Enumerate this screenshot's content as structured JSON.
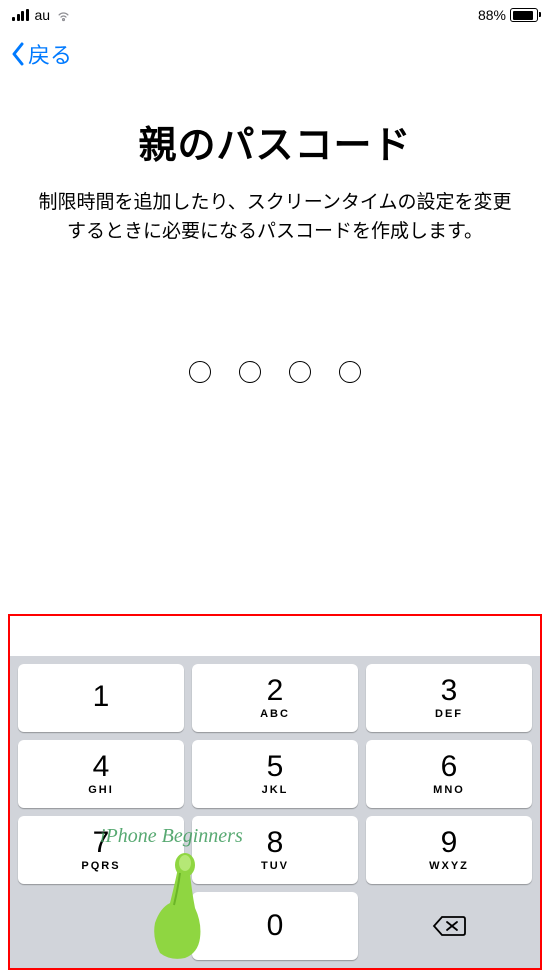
{
  "status_bar": {
    "carrier": "au",
    "battery_percent": "88%"
  },
  "nav": {
    "back_label": "戻る"
  },
  "content": {
    "title": "親のパスコード",
    "subtitle": "制限時間を追加したり、スクリーンタイムの設定を変更するときに必要になるパスコードを作成します。"
  },
  "passcode": {
    "length": 4,
    "filled": 0
  },
  "keypad": {
    "keys": [
      {
        "num": "1",
        "letters": ""
      },
      {
        "num": "2",
        "letters": "ABC"
      },
      {
        "num": "3",
        "letters": "DEF"
      },
      {
        "num": "4",
        "letters": "GHI"
      },
      {
        "num": "5",
        "letters": "JKL"
      },
      {
        "num": "6",
        "letters": "MNO"
      },
      {
        "num": "7",
        "letters": "PQRS"
      },
      {
        "num": "8",
        "letters": "TUV"
      },
      {
        "num": "9",
        "letters": "WXYZ"
      },
      {
        "num": "",
        "letters": ""
      },
      {
        "num": "0",
        "letters": ""
      }
    ]
  },
  "annotation": {
    "watermark": "iPhone Beginners",
    "highlight_color": "#ff0000"
  }
}
